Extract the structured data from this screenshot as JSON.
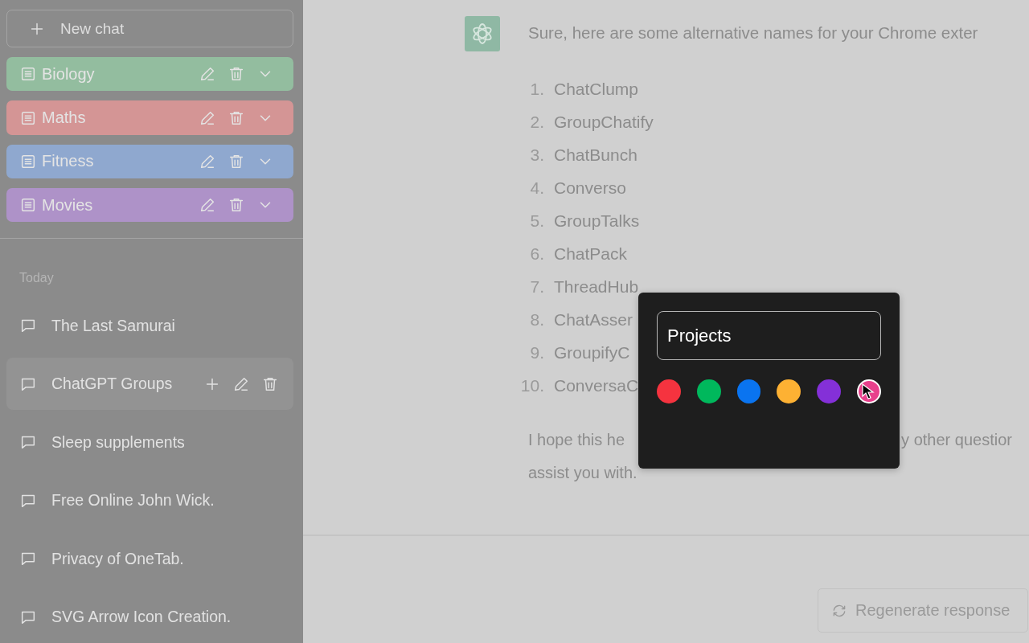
{
  "sidebar": {
    "new_chat": {
      "label": "New chat"
    },
    "folders": [
      {
        "name": "Biology",
        "color": "#93bd9f"
      },
      {
        "name": "Maths",
        "color": "#d49595"
      },
      {
        "name": "Fitness",
        "color": "#8fa8cf"
      },
      {
        "name": "Movies",
        "color": "#ae92c8"
      }
    ],
    "section_label": "Today",
    "chats": [
      {
        "title": "The Last Samurai",
        "selected": false
      },
      {
        "title": "ChatGPT Groups",
        "selected": true
      },
      {
        "title": "Sleep supplements",
        "selected": false
      },
      {
        "title": "Free Online John Wick.",
        "selected": false
      },
      {
        "title": "Privacy of OneTab.",
        "selected": false
      },
      {
        "title": "SVG Arrow Icon Creation.",
        "selected": false
      }
    ]
  },
  "message": {
    "intro": "Sure, here are some alternative names for your Chrome exter",
    "names": [
      {
        "number": "1.",
        "text": "ChatClump"
      },
      {
        "number": "2.",
        "text": "GroupChatify"
      },
      {
        "number": "3.",
        "text": "ChatBunch"
      },
      {
        "number": "4.",
        "text": "Converso"
      },
      {
        "number": "5.",
        "text": "GroupTalks"
      },
      {
        "number": "6.",
        "text": "ChatPack"
      },
      {
        "number": "7.",
        "text": "ThreadHub"
      },
      {
        "number": "8.",
        "text": "ChatAsser"
      },
      {
        "number": "9.",
        "text": "GroupifyC"
      },
      {
        "number": "10.",
        "text": "ConversaC"
      }
    ],
    "closing_left": "I hope this he",
    "closing_right": "y other questior",
    "closing_line2": "assist you with."
  },
  "popup": {
    "name_field": {
      "value": "Projects"
    },
    "swatches": [
      {
        "color": "#f5333f",
        "selected": false
      },
      {
        "color": "#00b85c",
        "selected": false
      },
      {
        "color": "#0a74f0",
        "selected": false
      },
      {
        "color": "#fdb133",
        "selected": false
      },
      {
        "color": "#8430d8",
        "selected": false
      },
      {
        "color": "#e8408c",
        "selected": true
      }
    ]
  },
  "regenerate_button": {
    "label": "Regenerate response"
  }
}
